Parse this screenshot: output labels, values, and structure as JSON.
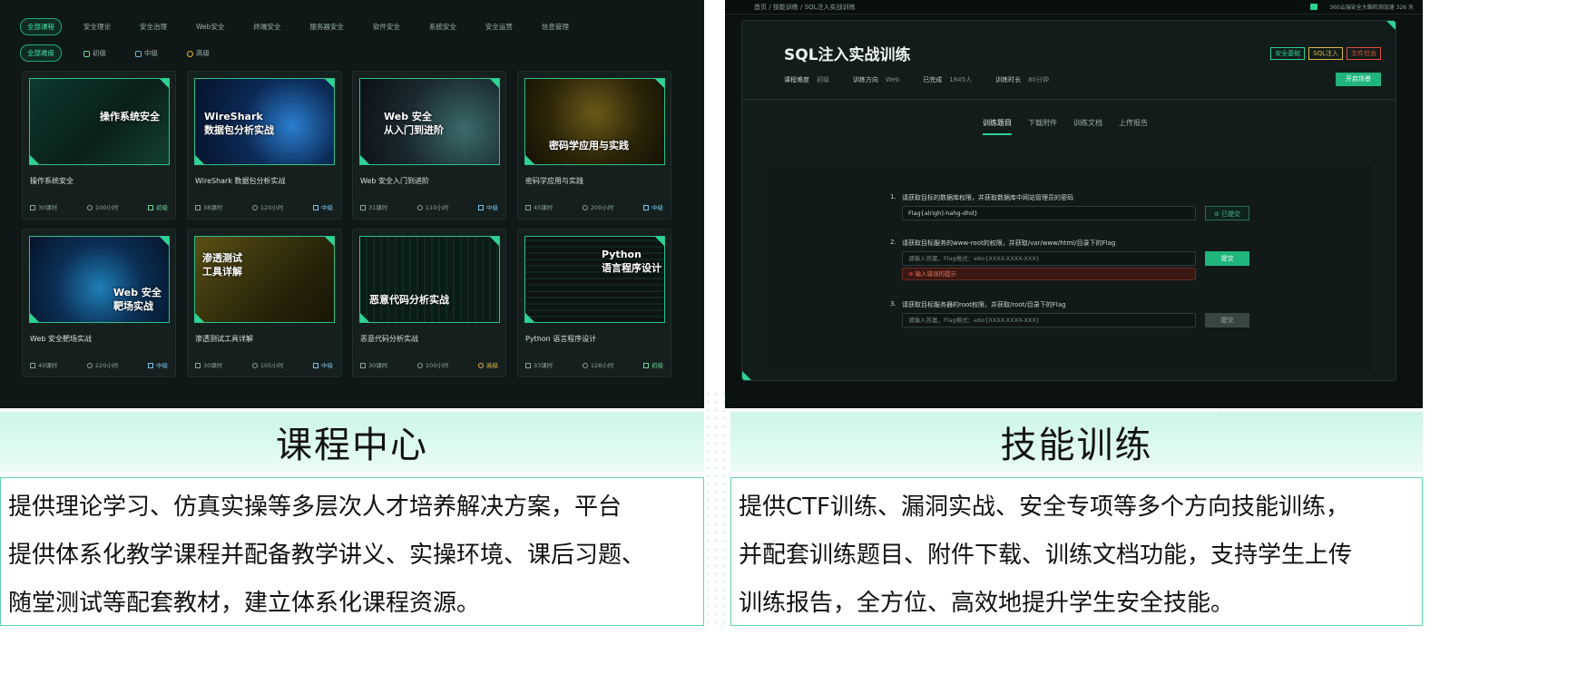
{
  "left_panel": {
    "categories": [
      "全部课程",
      "安全理论",
      "安全治理",
      "Web安全",
      "终端安全",
      "服务器安全",
      "软件安全",
      "系统安全",
      "安全运营",
      "信息管理"
    ],
    "levels": [
      "全部难度",
      "初级",
      "中级",
      "高级"
    ],
    "courses": [
      {
        "thumb_title": "操作系统安全",
        "title": "操作系统安全",
        "lessons": "30课时",
        "hours": "100小时",
        "level": "初级"
      },
      {
        "thumb_title": "WireShark\n数据包分析实战",
        "title": "WireShark 数据包分析实战",
        "lessons": "38课时",
        "hours": "120小时",
        "level": "中级"
      },
      {
        "thumb_title": "Web 安全\n从入门到进阶",
        "title": "Web 安全入门到进阶",
        "lessons": "31课时",
        "hours": "110小时",
        "level": "中级"
      },
      {
        "thumb_title": "密码学应用与实践",
        "title": "密码学应用与实践",
        "lessons": "45课时",
        "hours": "200小时",
        "level": "中级"
      },
      {
        "thumb_title": "Web 安全\n靶场实战",
        "title": "Web 安全靶场实战",
        "lessons": "49课时",
        "hours": "220小时",
        "level": "中级"
      },
      {
        "thumb_title": "渗透测试\n工具详解",
        "title": "渗透测试工具详解",
        "lessons": "30课时",
        "hours": "105小时",
        "level": "中级"
      },
      {
        "thumb_title": "恶意代码分析实战",
        "title": "恶意代码分析实战",
        "lessons": "30课时",
        "hours": "100小时",
        "level": "高级"
      },
      {
        "thumb_title": "Python\n语言程序设计",
        "title": "Python 语言程序设计",
        "lessons": "33课时",
        "hours": "128小时",
        "level": "初级"
      }
    ]
  },
  "right_panel": {
    "breadcrumb": "首页 / 技能训练 / SQL注入实战训练",
    "top_right": "360云端安全大脑检测加速 326 天",
    "title": "SQL注入实战训练",
    "info": [
      {
        "label": "课程难度",
        "value": "初级"
      },
      {
        "label": "训练方向",
        "value": "Web"
      },
      {
        "label": "已完成",
        "value": "1845人"
      },
      {
        "label": "训练时长",
        "value": "80分钟"
      }
    ],
    "tags": [
      "安全基础",
      "SQL注入",
      "文件包含"
    ],
    "start_button": "开启场景",
    "tabs": [
      "训练题目",
      "下载附件",
      "训练文档",
      "上传报告"
    ],
    "questions": [
      {
        "number": "1.",
        "text": "请获取目标的数据库权限，并获取数据库中网站管理员的密码",
        "value": "Flag{alrigh]-hahg-dhd}",
        "button": "已提交",
        "error": ""
      },
      {
        "number": "2.",
        "text": "请获取目标服务的www-root的权限，并获取/var/www/html/目录下的Flag",
        "placeholder": "请输入答案，Flag格式：e6o{XXXX-XXXX-XXX}",
        "button": "提交",
        "error": "输入错误的提示"
      },
      {
        "number": "3.",
        "text": "请获取目标服务器的root权限，并获取/root/目录下的Flag",
        "placeholder": "请输入答案，Flag格式：e6o{XXXX-XXXX-XXX}",
        "button": "提交",
        "error": ""
      }
    ]
  },
  "captions": {
    "left": "课程中心",
    "right": "技能训练"
  },
  "descriptions": {
    "left": [
      "提供理论学习、仿真实操等多层次人才培养解决方案，平台",
      "提供体系化教学课程并配备教学讲义、实操环境、课后习题、",
      "随堂测试等配套教材，建立体系化课程资源。"
    ],
    "right": [
      "提供CTF训练、漏洞实战、安全专项等多个方向技能训练，",
      "并配套训练题目、附件下载、训练文档功能，支持学生上传",
      "训练报告，全方位、高效地提升学生安全技能。"
    ]
  },
  "colors": {
    "accent": "#2fd294",
    "panel_bg": "#0f1816",
    "caption_bg": "#d4f7ea",
    "error": "#e0503c"
  }
}
